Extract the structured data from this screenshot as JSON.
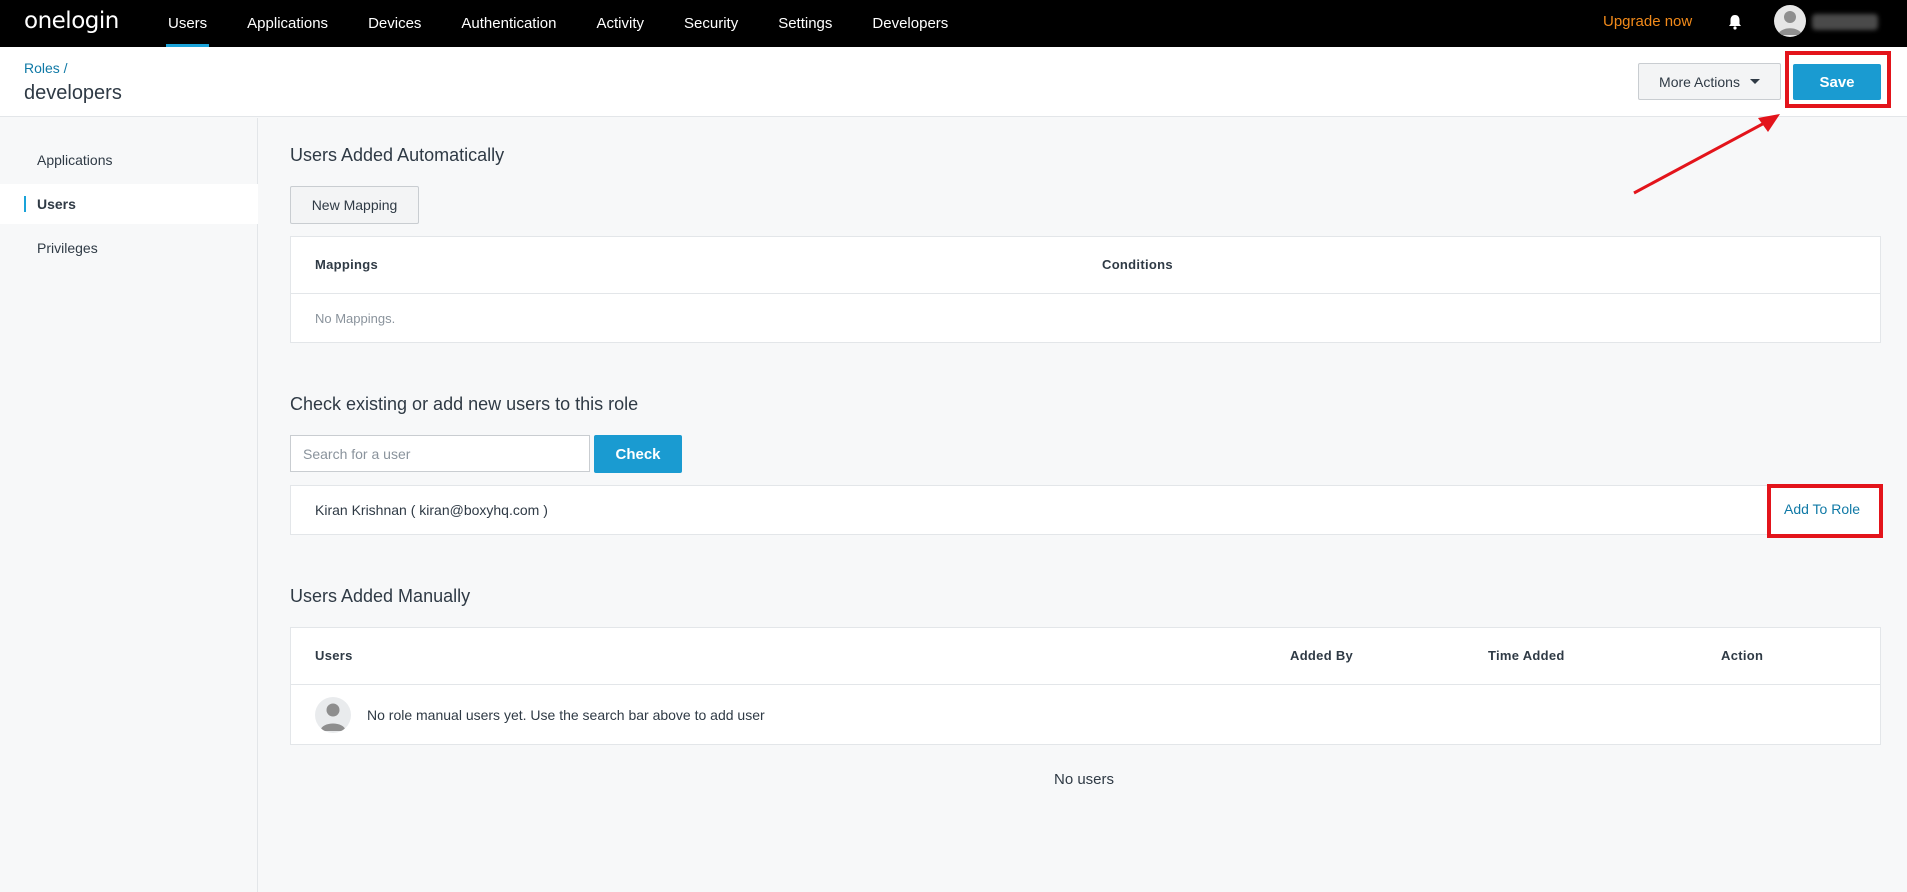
{
  "brand": {
    "logo_text": "onelogin"
  },
  "topnav": {
    "items": [
      {
        "label": "Users",
        "active": true
      },
      {
        "label": "Applications",
        "active": false
      },
      {
        "label": "Devices",
        "active": false
      },
      {
        "label": "Authentication",
        "active": false
      },
      {
        "label": "Activity",
        "active": false
      },
      {
        "label": "Security",
        "active": false
      },
      {
        "label": "Settings",
        "active": false
      },
      {
        "label": "Developers",
        "active": false
      }
    ],
    "upgrade_label": "Upgrade now",
    "bell_icon": "bell-icon",
    "avatar_icon": "user-avatar-icon"
  },
  "header": {
    "breadcrumb": "Roles /",
    "title": "developers",
    "more_actions_label": "More Actions",
    "save_label": "Save"
  },
  "sidebar": {
    "items": [
      {
        "label": "Applications",
        "active": false
      },
      {
        "label": "Users",
        "active": true
      },
      {
        "label": "Privileges",
        "active": false
      }
    ]
  },
  "auto_section": {
    "title": "Users Added Automatically",
    "new_mapping_label": "New Mapping",
    "col_mappings": "Mappings",
    "col_conditions": "Conditions",
    "empty_text": "No Mappings."
  },
  "check_section": {
    "title": "Check existing or add new users to this role",
    "search_placeholder": "Search for a user",
    "search_value": "",
    "check_label": "Check",
    "result_user": "Kiran Krishnan ( kiran@boxyhq.com )",
    "add_to_role_label": "Add To Role"
  },
  "manual_section": {
    "title": "Users Added Manually",
    "col_users": "Users",
    "col_added_by": "Added By",
    "col_time_added": "Time Added",
    "col_action": "Action",
    "empty_text": "No role manual users yet. Use the search bar above to add user",
    "no_users_text": "No users"
  },
  "colors": {
    "accent": "#1a9bd1",
    "link": "#0f79a6",
    "upgrade": "#f28a1a",
    "annotation_red": "#e3141b",
    "nav_bg": "#000000"
  }
}
